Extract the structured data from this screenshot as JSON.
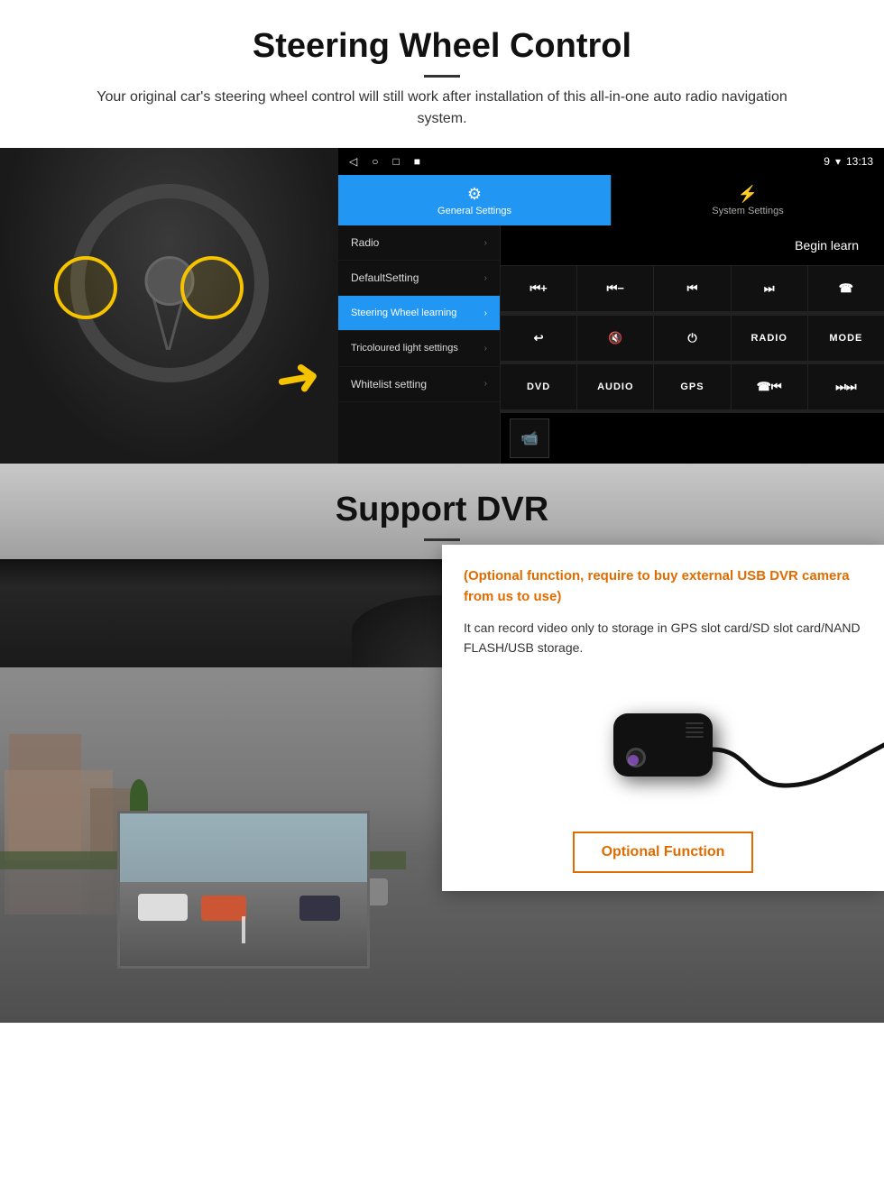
{
  "page": {
    "section1": {
      "title": "Steering Wheel Control",
      "description": "Your original car's steering wheel control will still work after installation of this all-in-one auto radio navigation system."
    },
    "section2": {
      "title": "Support DVR",
      "divider": true
    }
  },
  "android_ui": {
    "statusbar": {
      "time": "13:13",
      "nav_icons": [
        "◁",
        "○",
        "□",
        "■"
      ],
      "status_icons": [
        "9▾",
        "▾",
        "▾"
      ]
    },
    "tabs": {
      "active": {
        "label": "General Settings",
        "icon": "⚙"
      },
      "inactive": {
        "label": "System Settings",
        "icon": "⚡"
      }
    },
    "menu_items": [
      {
        "label": "Radio",
        "active": false
      },
      {
        "label": "DefaultSetting",
        "active": false
      },
      {
        "label": "Steering Wheel learning",
        "active": true
      },
      {
        "label": "Tricoloured light settings",
        "active": false
      },
      {
        "label": "Whitelist setting",
        "active": false
      }
    ],
    "begin_learn": "Begin learn",
    "control_buttons": [
      {
        "label": "⏮+",
        "type": "icon"
      },
      {
        "label": "⏮−",
        "type": "icon"
      },
      {
        "label": "⏮⏮",
        "type": "icon"
      },
      {
        "label": "⏭⏭",
        "type": "icon"
      },
      {
        "label": "☎",
        "type": "icon"
      },
      {
        "label": "↩",
        "type": "icon"
      },
      {
        "label": "🔇",
        "type": "icon"
      },
      {
        "label": "⏻",
        "type": "icon"
      },
      {
        "label": "RADIO",
        "type": "text"
      },
      {
        "label": "MODE",
        "type": "text"
      },
      {
        "label": "DVD",
        "type": "text"
      },
      {
        "label": "AUDIO",
        "type": "text"
      },
      {
        "label": "GPS",
        "type": "text"
      },
      {
        "label": "☎⏮",
        "type": "icon"
      },
      {
        "label": "⏭⏭",
        "type": "icon"
      }
    ],
    "dvr_bottom_icon": "📹"
  },
  "dvr_section": {
    "optional_text": "(Optional function, require to buy external USB DVR camera from us to use)",
    "description": "It can record video only to storage in GPS slot card/SD slot card/NAND FLASH/USB storage.",
    "optional_btn_label": "Optional Function"
  }
}
